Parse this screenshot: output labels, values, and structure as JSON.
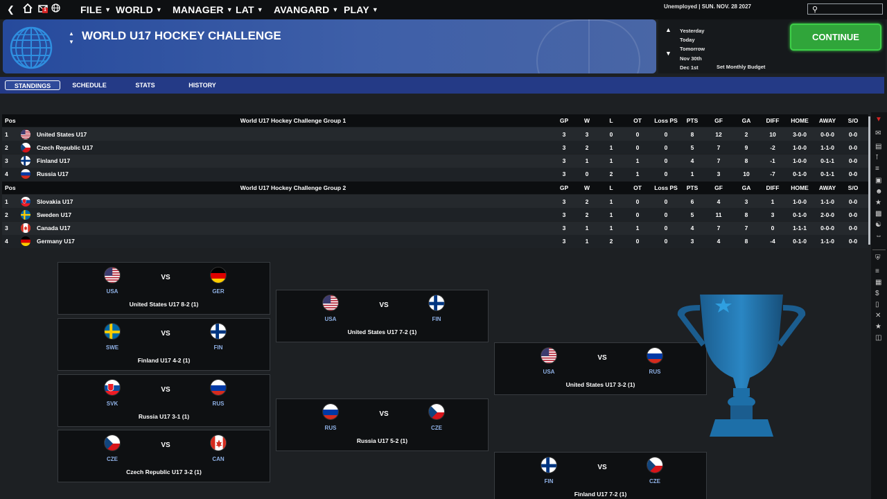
{
  "topbar": {
    "menus": [
      "FILE",
      "WORLD",
      "MANAGER",
      "LAT",
      "AVANGARD",
      "PLAY"
    ],
    "status": "Unemployed | SUN. NOV. 28 2027",
    "notification_count": "1"
  },
  "header": {
    "title": "WORLD U17 HOCKEY CHALLENGE",
    "date_options": [
      "Yesterday",
      "Today",
      "Tomorrow",
      "Nov 30th",
      "Dec 1st"
    ],
    "budget_label": "Set Monthly Budget",
    "continue_label": "CONTINUE"
  },
  "tabs": [
    "STANDINGS",
    "SCHEDULE",
    "STATS",
    "HISTORY"
  ],
  "active_tab": "STANDINGS",
  "standings": {
    "columns": [
      "Pos",
      "GP",
      "W",
      "L",
      "OT",
      "Loss PS",
      "PTS",
      "GF",
      "GA",
      "DIFF",
      "HOME",
      "AWAY",
      "S/O"
    ],
    "groups": [
      {
        "name": "World U17 Hockey Challenge Group 1",
        "rows": [
          {
            "pos": "1",
            "flag": "usa",
            "team": "United States U17",
            "gp": "3",
            "w": "3",
            "l": "0",
            "ot": "0",
            "lossps": "0",
            "pts": "8",
            "gf": "12",
            "ga": "2",
            "diff": "10",
            "home": "3-0-0",
            "away": "0-0-0",
            "so": "0-0"
          },
          {
            "pos": "2",
            "flag": "cze",
            "team": "Czech Republic U17",
            "gp": "3",
            "w": "2",
            "l": "1",
            "ot": "0",
            "lossps": "0",
            "pts": "5",
            "gf": "7",
            "ga": "9",
            "diff": "-2",
            "home": "1-0-0",
            "away": "1-1-0",
            "so": "0-0"
          },
          {
            "pos": "3",
            "flag": "fin",
            "team": "Finland U17",
            "gp": "3",
            "w": "1",
            "l": "1",
            "ot": "1",
            "lossps": "0",
            "pts": "4",
            "gf": "7",
            "ga": "8",
            "diff": "-1",
            "home": "1-0-0",
            "away": "0-1-1",
            "so": "0-0"
          },
          {
            "pos": "4",
            "flag": "rus",
            "team": "Russia U17",
            "gp": "3",
            "w": "0",
            "l": "2",
            "ot": "1",
            "lossps": "0",
            "pts": "1",
            "gf": "3",
            "ga": "10",
            "diff": "-7",
            "home": "0-1-0",
            "away": "0-1-1",
            "so": "0-0"
          }
        ]
      },
      {
        "name": "World U17 Hockey Challenge Group 2",
        "rows": [
          {
            "pos": "1",
            "flag": "svk",
            "team": "Slovakia U17",
            "gp": "3",
            "w": "2",
            "l": "1",
            "ot": "0",
            "lossps": "0",
            "pts": "6",
            "gf": "4",
            "ga": "3",
            "diff": "1",
            "home": "1-0-0",
            "away": "1-1-0",
            "so": "0-0"
          },
          {
            "pos": "2",
            "flag": "swe",
            "team": "Sweden U17",
            "gp": "3",
            "w": "2",
            "l": "1",
            "ot": "0",
            "lossps": "0",
            "pts": "5",
            "gf": "11",
            "ga": "8",
            "diff": "3",
            "home": "0-1-0",
            "away": "2-0-0",
            "so": "0-0"
          },
          {
            "pos": "3",
            "flag": "can",
            "team": "Canada U17",
            "gp": "3",
            "w": "1",
            "l": "1",
            "ot": "1",
            "lossps": "0",
            "pts": "4",
            "gf": "7",
            "ga": "7",
            "diff": "0",
            "home": "1-1-1",
            "away": "0-0-0",
            "so": "0-0"
          },
          {
            "pos": "4",
            "flag": "ger",
            "team": "Germany U17",
            "gp": "3",
            "w": "1",
            "l": "2",
            "ot": "0",
            "lossps": "0",
            "pts": "3",
            "gf": "4",
            "ga": "8",
            "diff": "-4",
            "home": "0-1-0",
            "away": "1-1-0",
            "so": "0-0"
          }
        ]
      }
    ]
  },
  "bracket": {
    "matches": [
      {
        "home": "USA",
        "away": "GER",
        "home_flag": "usa",
        "away_flag": "ger",
        "result": "United States U17 8-2 (1)"
      },
      {
        "home": "SWE",
        "away": "FIN",
        "home_flag": "swe",
        "away_flag": "fin",
        "result": "Finland U17 4-2 (1)"
      },
      {
        "home": "SVK",
        "away": "RUS",
        "home_flag": "svk",
        "away_flag": "rus",
        "result": "Russia U17 3-1 (1)"
      },
      {
        "home": "CZE",
        "away": "CAN",
        "home_flag": "cze",
        "away_flag": "can",
        "result": "Czech Republic U17 3-2 (1)"
      },
      {
        "home": "USA",
        "away": "FIN",
        "home_flag": "usa",
        "away_flag": "fin",
        "result": "United States U17 7-2 (1)"
      },
      {
        "home": "RUS",
        "away": "CZE",
        "home_flag": "rus",
        "away_flag": "cze",
        "result": "Russia U17 5-2 (1)"
      },
      {
        "home": "USA",
        "away": "RUS",
        "home_flag": "usa",
        "away_flag": "rus",
        "result": "United States U17 3-2 (1)"
      },
      {
        "home": "FIN",
        "away": "CZE",
        "home_flag": "fin",
        "away_flag": "cze",
        "result": "Finland U17 7-2 (1)"
      }
    ],
    "vs_label": "VS"
  },
  "colors": {
    "accent": "#243a86",
    "continue": "#30a53a",
    "abbr": "#8fb1e6",
    "trophy": "#1d6fa8"
  }
}
